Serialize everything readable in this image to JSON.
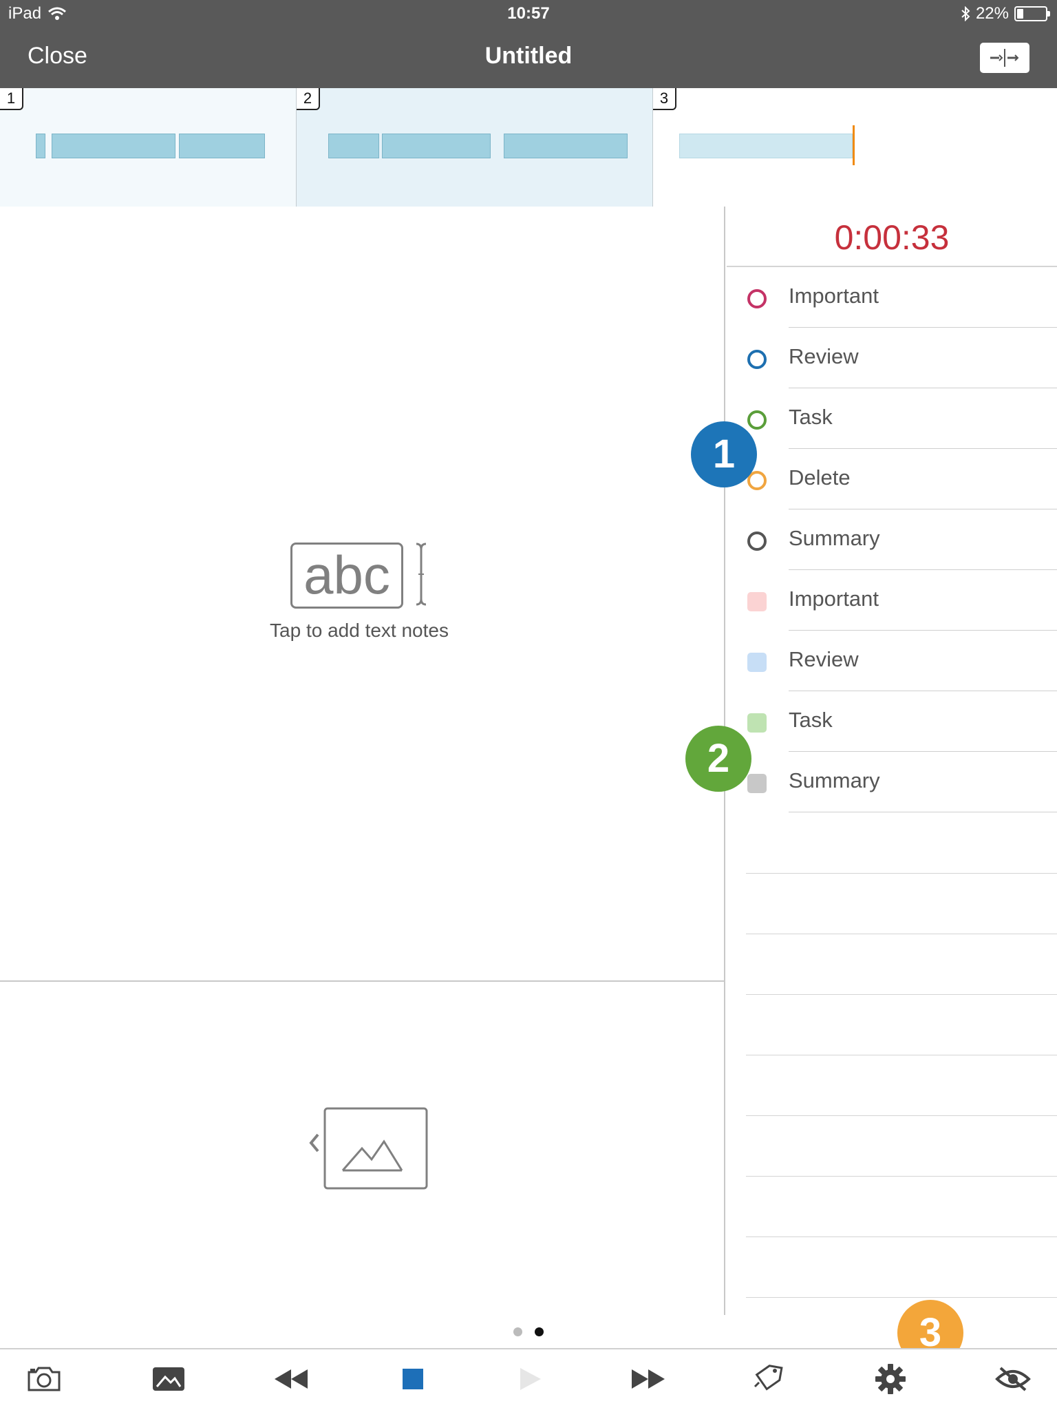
{
  "status_bar": {
    "device": "iPad",
    "time": "10:57",
    "battery_percent": "22%",
    "battery_level": 0.22
  },
  "nav": {
    "close_label": "Close",
    "title": "Untitled",
    "action_icon": "split-clip-icon"
  },
  "timeline": {
    "pages": [
      {
        "number": "1"
      },
      {
        "number": "2"
      },
      {
        "number": "3"
      }
    ]
  },
  "notes": {
    "icon_text": "abc",
    "hint": "Tap to add text notes"
  },
  "panel": {
    "timer": "0:00:33",
    "tags": [
      {
        "label": "Important",
        "style": "ring",
        "color": "#c43366"
      },
      {
        "label": "Review",
        "style": "ring",
        "color": "#1d6fb0"
      },
      {
        "label": "Task",
        "style": "ring",
        "color": "#5a9e3a"
      },
      {
        "label": "Delete",
        "style": "ring",
        "color": "#f0a540"
      },
      {
        "label": "Summary",
        "style": "ring",
        "color": "#555555"
      },
      {
        "label": "Important",
        "style": "square",
        "color": "#fbd3d3"
      },
      {
        "label": "Review",
        "style": "square",
        "color": "#c7def6"
      },
      {
        "label": "Task",
        "style": "square",
        "color": "#bfe3b2"
      },
      {
        "label": "Summary",
        "style": "square",
        "color": "#c8c8c8"
      }
    ]
  },
  "callouts": [
    "1",
    "2",
    "3"
  ],
  "page_indicator": {
    "count": 2,
    "active": 2
  },
  "toolbar": {
    "buttons": [
      "camera-icon",
      "photo-library-icon",
      "rewind-icon",
      "stop-icon",
      "play-icon",
      "fast-forward-icon",
      "tag-icon",
      "settings-icon",
      "hide-icon"
    ]
  },
  "colors": {
    "topbar": "#595959",
    "timer": "#c6303c",
    "stop_button": "#1d6fb8",
    "playhead": "#f08a10"
  }
}
